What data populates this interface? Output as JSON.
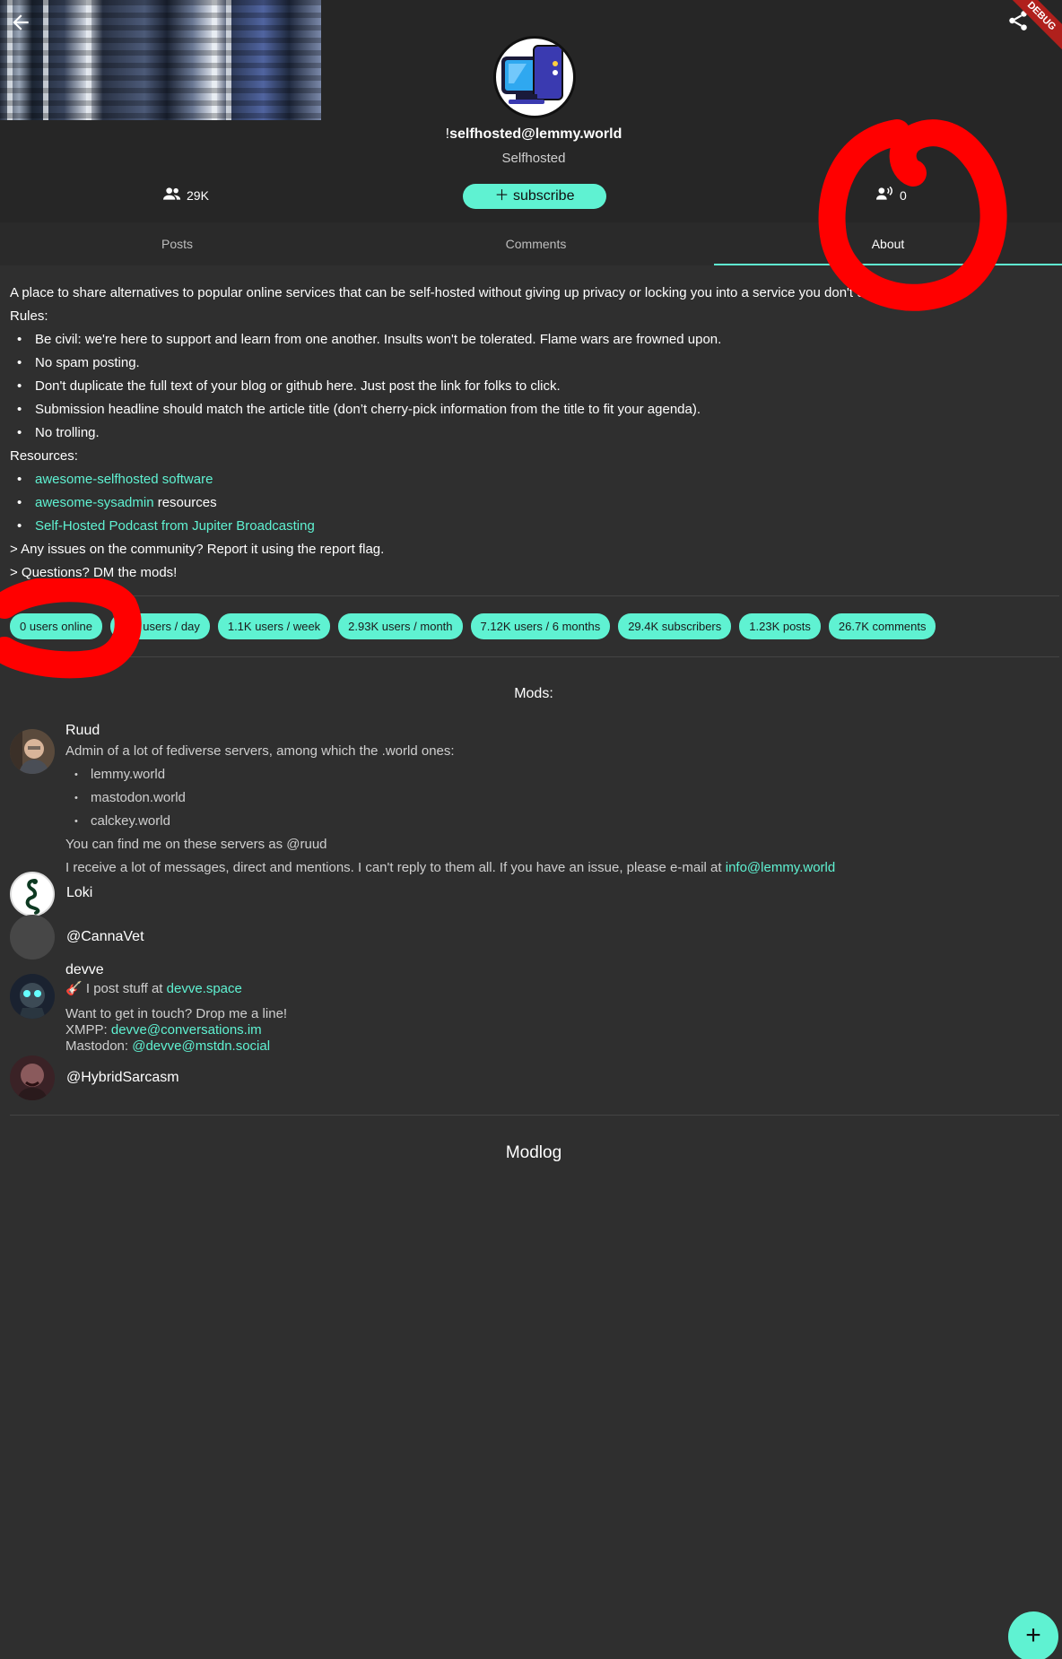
{
  "header": {
    "community_prefix": "!",
    "community_name": "selfhosted",
    "community_instance": "@lemmy.world",
    "community_title": "Selfhosted",
    "subscribers_count": "29K",
    "subscribe_label": "subscribe",
    "active_count": "0",
    "debug_label": "DEBUG"
  },
  "tabs": [
    {
      "label": "Posts"
    },
    {
      "label": "Comments"
    },
    {
      "label": "About"
    }
  ],
  "about": {
    "intro": "A place to share alternatives to popular online services that can be self-hosted without giving up privacy or locking you into a service you don't control.",
    "rules_heading": "Rules:",
    "rules": [
      "Be civil: we're here to support and learn from one another. Insults won't be tolerated. Flame wars are frowned upon.",
      "No spam posting.",
      "Don't duplicate the full text of your  blog or github here. Just post the link for folks to click.",
      "Submission headline should match the article title (don’t cherry-pick information from the title to fit your agenda).",
      "No trolling."
    ],
    "resources_heading": "Resources:",
    "resources": [
      {
        "link": "awesome-selfhosted software",
        "suffix": ""
      },
      {
        "link": "awesome-sysadmin",
        "suffix": " resources"
      },
      {
        "link": "Self-Hosted Podcast from Jupiter Broadcasting",
        "suffix": ""
      }
    ],
    "footer_lines": [
      "> Any issues on the community? Report it using the report flag.",
      "> Questions? DM the mods!"
    ]
  },
  "stats_chips": [
    "0 users online",
    "246 users / day",
    "1.1K users / week",
    "2.93K users / month",
    "7.12K users / 6 months",
    "29.4K subscribers",
    "1.23K posts",
    "26.7K comments"
  ],
  "mods_heading": "Mods:",
  "mods": {
    "ruud": {
      "name": "Ruud",
      "bio_intro": "Admin of a lot of fediverse servers, among which the .world ones:",
      "servers": [
        "lemmy.world",
        "mastodon.world",
        "calckey.world"
      ],
      "find_me": "You can find me on these servers as @ruud",
      "messages_text": "I receive a lot of messages, direct and mentions. I can't reply to them all. If you have an issue, please e-mail at ",
      "email": "info@lemmy.world"
    },
    "loki": {
      "name": "Loki"
    },
    "cannavet": {
      "name": "@CannaVet"
    },
    "devve": {
      "name": "devve",
      "line1_text": "I post stuff at ",
      "line1_link": "devve.space",
      "line2": "Want to get in touch? Drop me a line!",
      "xmpp_label": "XMPP: ",
      "xmpp_link": "devve@conversations.im",
      "mastodon_label": "Mastodon: ",
      "mastodon_link": "@devve@mstdn.social"
    },
    "hybrid": {
      "name": "@HybridSarcasm"
    }
  },
  "modlog_heading": "Modlog",
  "fab_label": "+",
  "colors": {
    "accent": "#5ff2d2",
    "background": "#2f2f2f",
    "header_background": "#262626",
    "annotation_red": "#ff0000"
  },
  "icons": {
    "back": "arrow-left-icon",
    "share": "share-icon",
    "subscribers": "people-icon",
    "active": "voice-person-icon",
    "add": "plus-icon"
  }
}
